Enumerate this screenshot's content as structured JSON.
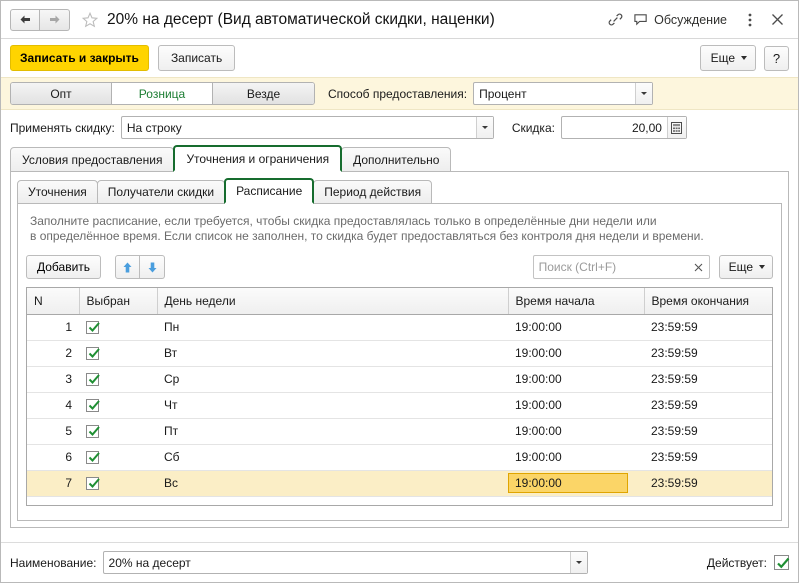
{
  "titlebar": {
    "back_icon": "arrow-left-icon",
    "forward_icon": "arrow-right-icon",
    "favorite_icon": "star-icon",
    "title": "20% на десерт (Вид автоматической скидки, наценки)",
    "link_icon": "link-icon",
    "discussion_icon": "speech-bubble-icon",
    "discussion_label": "Обсуждение",
    "menu_icon": "kebab-menu-icon",
    "close_icon": "close-icon"
  },
  "commandbar": {
    "save_and_close_label": "Записать и закрыть",
    "save_label": "Записать",
    "more_label": "Еще",
    "help_label": "?"
  },
  "strip": {
    "segments": [
      {
        "label": "Опт",
        "selected": false
      },
      {
        "label": "Розница",
        "selected": true
      },
      {
        "label": "Везде",
        "selected": false
      }
    ],
    "method_label": "Способ предоставления:",
    "method_value": "Процент"
  },
  "discount_row": {
    "apply_label": "Применять скидку:",
    "apply_value": "На строку",
    "discount_label": "Скидка:",
    "discount_value": "20,00",
    "calculator_icon": "calculator-icon"
  },
  "outer_tabs": [
    {
      "label": "Условия предоставления",
      "selected": false
    },
    {
      "label": "Уточнения и ограничения",
      "selected": true
    },
    {
      "label": "Дополнительно",
      "selected": false
    }
  ],
  "inner_tabs": [
    {
      "label": "Уточнения",
      "selected": false
    },
    {
      "label": "Получатели скидки",
      "selected": false
    },
    {
      "label": "Расписание",
      "selected": true
    },
    {
      "label": "Период действия",
      "selected": false
    }
  ],
  "hint": {
    "line1": "Заполните расписание, если требуется, чтобы скидка предоставлялась только в определённые дни недели или",
    "line2": "в определённое время. Если список не заполнен, то скидка будет предоставляться без контроля дня недели и времени."
  },
  "gridbar": {
    "add_label": "Добавить",
    "move_up_icon": "arrow-up-icon",
    "move_down_icon": "arrow-down-icon",
    "search_placeholder": "Поиск (Ctrl+F)",
    "search_value": "",
    "search_clear_icon": "clear-x-icon",
    "more_label": "Еще"
  },
  "table": {
    "headers": [
      "N",
      "Выбран",
      "День недели",
      "Время начала",
      "Время окончания"
    ],
    "rows": [
      {
        "n": "1",
        "checked": true,
        "day": "Пн",
        "start": "19:00:00",
        "end": "23:59:59",
        "selected": false
      },
      {
        "n": "2",
        "checked": true,
        "day": "Вт",
        "start": "19:00:00",
        "end": "23:59:59",
        "selected": false
      },
      {
        "n": "3",
        "checked": true,
        "day": "Ср",
        "start": "19:00:00",
        "end": "23:59:59",
        "selected": false
      },
      {
        "n": "4",
        "checked": true,
        "day": "Чт",
        "start": "19:00:00",
        "end": "23:59:59",
        "selected": false
      },
      {
        "n": "5",
        "checked": true,
        "day": "Пт",
        "start": "19:00:00",
        "end": "23:59:59",
        "selected": false
      },
      {
        "n": "6",
        "checked": true,
        "day": "Сб",
        "start": "19:00:00",
        "end": "23:59:59",
        "selected": false
      },
      {
        "n": "7",
        "checked": true,
        "day": "Вс",
        "start": "19:00:00",
        "end": "23:59:59",
        "selected": true
      }
    ]
  },
  "bottombar": {
    "name_label": "Наименование:",
    "name_value": "20% на десерт",
    "active_label": "Действует:",
    "active_checked": true
  },
  "colors": {
    "accent_yellow": "#ffd400",
    "selected_tab_green": "#166c2e",
    "row_highlight": "#fbeec6",
    "cell_highlight": "#fbd567",
    "strip_bg": "#fdf6dd",
    "check_green": "#1f8f33"
  }
}
